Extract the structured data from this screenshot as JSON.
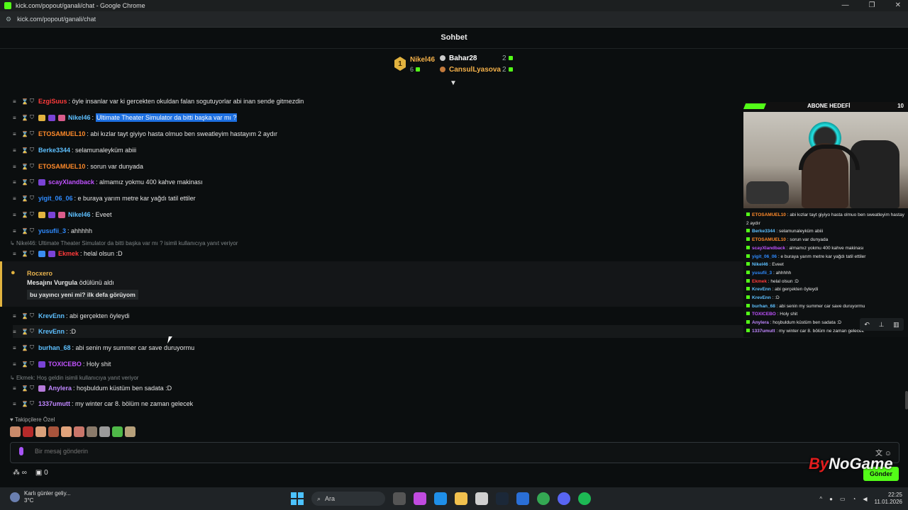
{
  "window": {
    "title": "kick.com/popout/ganali/chat - Google Chrome",
    "url": "kick.com/popout/ganali/chat",
    "controls": [
      "—",
      "❐",
      "✕"
    ]
  },
  "chat": {
    "title": "Sohbet",
    "leaderboard": {
      "first": {
        "rank": "1",
        "name": "Nikel46",
        "value": "6"
      },
      "second": {
        "name": "Bahar28",
        "value": "2"
      },
      "third": {
        "name": "CansulLyasova",
        "value": "2"
      }
    },
    "messages": [
      {
        "user": "EzgiSuus",
        "text": ": öyle insanlar var ki gercekten okuldan falan sogutuyorlar abi inan sende gitmezdin",
        "color": "#ff3b3b"
      },
      {
        "user": "Nikel46",
        "text": ":",
        "highlight": "Ultimate Theater Simulator da bitti başka var mı ?",
        "color": "#5ec0ff"
      },
      {
        "user": "ETOSAMUEL10",
        "text": ": abi kızlar tayt giyiyo hasta olmuo ben sweatleyim hastayım 2 aydır",
        "color": "#ff8a2a"
      },
      {
        "user": "Berke3344",
        "text": ": selamunaleyküm abiii",
        "color": "#5ec0ff"
      },
      {
        "user": "ETOSAMUEL10",
        "text": ": sorun var dunyada",
        "color": "#ff8a2a"
      },
      {
        "user": "scayXlandback",
        "text": ": almamız yokmu 400 kahve makinası",
        "color": "#c052ff"
      },
      {
        "user": "yigit_06_06",
        "text": ": e buraya yarım metre kar yağdı tatil ettiler",
        "color": "#2f8bff"
      },
      {
        "user": "Nikel46",
        "text": ": Eveet",
        "color": "#5ec0ff"
      },
      {
        "user": "yusufii_3",
        "text": ": ahhhhh",
        "color": "#2f8bff"
      },
      {
        "user": "Ekmek",
        "text": ": helal olsun :D",
        "color": "#ff3b3b"
      },
      {
        "user": "KrevEnn",
        "text": ": abi gerçekten öyleydi",
        "color": "#5ec0ff"
      },
      {
        "user": "KrevEnn",
        "text": ": :D",
        "color": "#5ec0ff"
      },
      {
        "user": "burhan_68",
        "text": ": abi senin my summer car save duruyormu",
        "color": "#5ec0ff"
      },
      {
        "user": "TOXICEBO",
        "text": ": Holy shit",
        "color": "#c052ff"
      },
      {
        "user": "Anylera",
        "text": ": hoşbuldum küstüm ben sadata :D",
        "color": "#c087ff"
      },
      {
        "user": "1337umutt",
        "text": ": my winter car 8. bölüm ne zaman gelecek",
        "color": "#c087ff"
      }
    ],
    "replies": {
      "r1": "Nikel46: Ultimate Theater Simulator da bitti başka var mı ? isimli kullanıcıya yanıt veriyor",
      "r2": "Ekmek: Hoş geldin isimli kullanıcıya yanıt veriyor"
    },
    "redemption": {
      "user": "Rocxero",
      "title_bold": "Mesajını Vurgula",
      "title_rest": " ödülünü aldı",
      "message": "bu yayıncı yeni mi? ilk defa görüyom"
    },
    "followers_label": "Takipçilere Özel",
    "input_placeholder": "Bir mesaj gönderin",
    "send_label": "Gönder",
    "bottom_count": "0",
    "infinity": "∞"
  },
  "overlay": {
    "sub_goal_title": "ABONE HEDEFİ",
    "sub_goal_count": "10",
    "lines": [
      {
        "user": "ETOSAMUEL10",
        "text": " : abi kızlar tayt giyiyo hasta olmuo ben sweatleyim hastay",
        "color": "#ff8a2a"
      },
      {
        "user": "",
        "text": "2 aydır",
        "color": "#fff"
      },
      {
        "user": "Berke3344",
        "text": " : selamunaleyküm abiii",
        "color": "#5ec0ff"
      },
      {
        "user": "ETOSAMUEL10",
        "text": " : sorun var dunyada",
        "color": "#ff8a2a"
      },
      {
        "user": "scayXlandback",
        "text": " : almamız yokmu 400 kahve makinası",
        "color": "#c052ff"
      },
      {
        "user": "yigit_06_06",
        "text": " : e buraya yarım metre kar yağdı tatil ettiler",
        "color": "#2f8bff"
      },
      {
        "user": "Nikel46",
        "text": " : Eveet",
        "color": "#5ec0ff"
      },
      {
        "user": "yusufii_3",
        "text": " : ahhhhh",
        "color": "#2f8bff"
      },
      {
        "user": "Ekmek",
        "text": " : helal olsun :D",
        "color": "#ff3b3b"
      },
      {
        "user": "KrevEnn",
        "text": " : abi gerçekten öyleydi",
        "color": "#5ec0ff"
      },
      {
        "user": "KrevEnn",
        "text": " : :D",
        "color": "#5ec0ff"
      },
      {
        "user": "burhan_68",
        "text": " : abi senin my summer car save duruyormu",
        "color": "#5ec0ff"
      },
      {
        "user": "TOXICEBO",
        "text": " : Holy shit",
        "color": "#c052ff"
      },
      {
        "user": "Anylera",
        "text": " : hoşbuldum küstüm ben sadata :D",
        "color": "#c087ff"
      },
      {
        "user": "1337umutt",
        "text": " : my winter car 8. bölüm ne zaman gelecek",
        "color": "#c087ff"
      }
    ]
  },
  "watermark": {
    "prefix": "By",
    "brand": "NoGame"
  },
  "taskbar": {
    "weather_title": "Karlı günler geliy...",
    "weather_temp": "3°C",
    "search": "Ara",
    "time": "22:25",
    "date": "11.01.2026"
  },
  "colors": {
    "accent": "#53fc18",
    "gold": "#e2b33f"
  }
}
